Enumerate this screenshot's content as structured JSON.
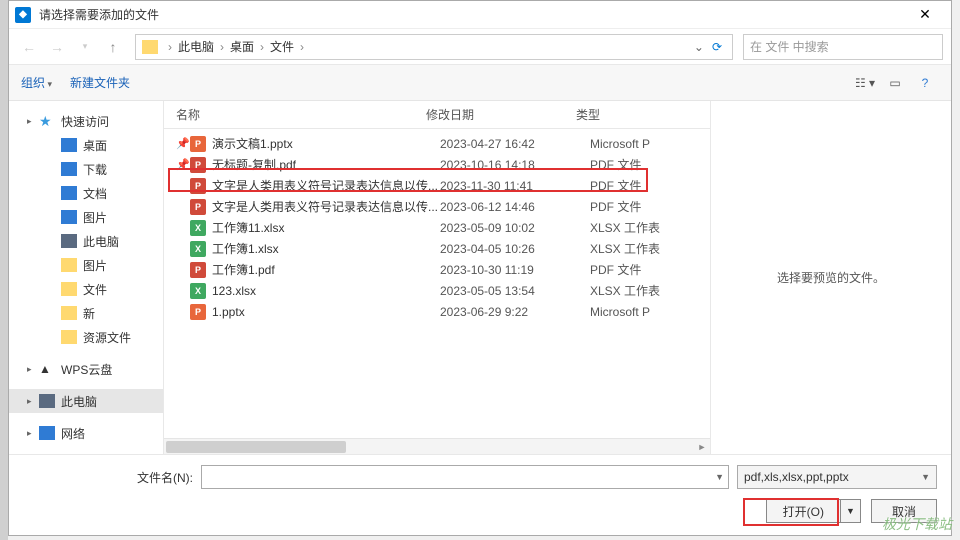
{
  "title": "请选择需要添加的文件",
  "breadcrumb": {
    "items": [
      "此电脑",
      "桌面",
      "文件"
    ]
  },
  "search": {
    "placeholder": "在 文件 中搜索"
  },
  "toolbar": {
    "organize": "组织",
    "newfolder": "新建文件夹"
  },
  "columns": {
    "name": "名称",
    "date": "修改日期",
    "type": "类型"
  },
  "sidebar": {
    "quick": "快速访问",
    "desktop": "桌面",
    "downloads": "下载",
    "documents": "文档",
    "pictures": "图片",
    "thispc": "此电脑",
    "pictures2": "图片",
    "files": "文件",
    "new": "新",
    "resources": "资源文件",
    "wps": "WPS云盘",
    "thispc2": "此电脑",
    "network": "网络"
  },
  "files": [
    {
      "icon": "ppt",
      "pin": true,
      "name": "演示文稿1.pptx",
      "date": "2023-04-27 16:42",
      "type": "Microsoft P"
    },
    {
      "icon": "pdf",
      "pin": true,
      "name": "无标题-复制.pdf",
      "date": "2023-10-16 14:18",
      "type": "PDF 文件"
    },
    {
      "icon": "pdf",
      "pin": false,
      "name": "文字是人类用表义符号记录表达信息以传...",
      "date": "2023-11-30 11:41",
      "type": "PDF 文件"
    },
    {
      "icon": "pdf",
      "pin": false,
      "name": "文字是人类用表义符号记录表达信息以传...",
      "date": "2023-06-12 14:46",
      "type": "PDF 文件"
    },
    {
      "icon": "xls",
      "pin": false,
      "name": "工作簿11.xlsx",
      "date": "2023-05-09 10:02",
      "type": "XLSX 工作表"
    },
    {
      "icon": "xls",
      "pin": false,
      "name": "工作簿1.xlsx",
      "date": "2023-04-05 10:26",
      "type": "XLSX 工作表"
    },
    {
      "icon": "pdf",
      "pin": false,
      "name": "工作簿1.pdf",
      "date": "2023-10-30 11:19",
      "type": "PDF 文件"
    },
    {
      "icon": "xls",
      "pin": false,
      "name": "123.xlsx",
      "date": "2023-05-05 13:54",
      "type": "XLSX 工作表"
    },
    {
      "icon": "ppt",
      "pin": false,
      "name": "1.pptx",
      "date": "2023-06-29 9:22",
      "type": "Microsoft P"
    }
  ],
  "preview": {
    "text": "选择要预览的文件。"
  },
  "footer": {
    "filename_label": "文件名(N):",
    "filter": "pdf,xls,xlsx,ppt,pptx",
    "open": "打开(O)",
    "cancel": "取消"
  },
  "watermark": "极光下载站"
}
